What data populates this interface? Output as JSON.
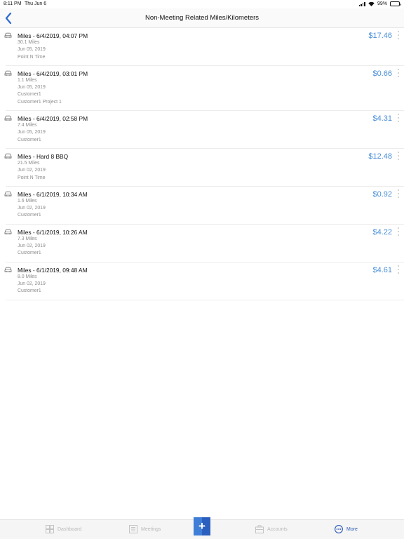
{
  "status_bar": {
    "time": "8:11 PM",
    "date": "Thu Jun 6",
    "battery": "99%"
  },
  "nav": {
    "title": "Non-Meeting Related Miles/Kilometers"
  },
  "entries": [
    {
      "title": "Miles - 6/4/2019, 04:07 PM",
      "amount": "$17.46",
      "details": [
        "30.1 Miles",
        "Jun 05, 2019",
        "Point N Time"
      ]
    },
    {
      "title": "Miles - 6/4/2019, 03:01 PM",
      "amount": "$0.66",
      "details": [
        "1.1 Miles",
        "Jun 05, 2019",
        "Customer1",
        "Customer1 Project 1"
      ]
    },
    {
      "title": "Miles - 6/4/2019, 02:58 PM",
      "amount": "$4.31",
      "details": [
        "7.4 Miles",
        "Jun 05, 2019",
        "Customer1"
      ]
    },
    {
      "title": "Miles - Hard 8 BBQ",
      "amount": "$12.48",
      "details": [
        "21.5 Miles",
        "Jun 02, 2019",
        "Point N Time"
      ]
    },
    {
      "title": "Miles - 6/1/2019, 10:34 AM",
      "amount": "$0.92",
      "details": [
        "1.6 Miles",
        "Jun 02, 2019",
        "Customer1"
      ]
    },
    {
      "title": "Miles - 6/1/2019, 10:26 AM",
      "amount": "$4.22",
      "details": [
        "7.3 Miles",
        "Jun 02, 2019",
        "Customer1"
      ]
    },
    {
      "title": "Miles - 6/1/2019, 09:48 AM",
      "amount": "$4.61",
      "details": [
        "8.0 Miles",
        "Jun 02, 2019",
        "Customer1"
      ]
    }
  ],
  "tabs": {
    "dashboard": "Dashboard",
    "meetings": "Meetings",
    "accounts": "Accounts",
    "more": "More"
  },
  "colors": {
    "accent": "#4a90d9",
    "active_tab": "#2e5cb8",
    "fab": "#3e7ed6"
  }
}
